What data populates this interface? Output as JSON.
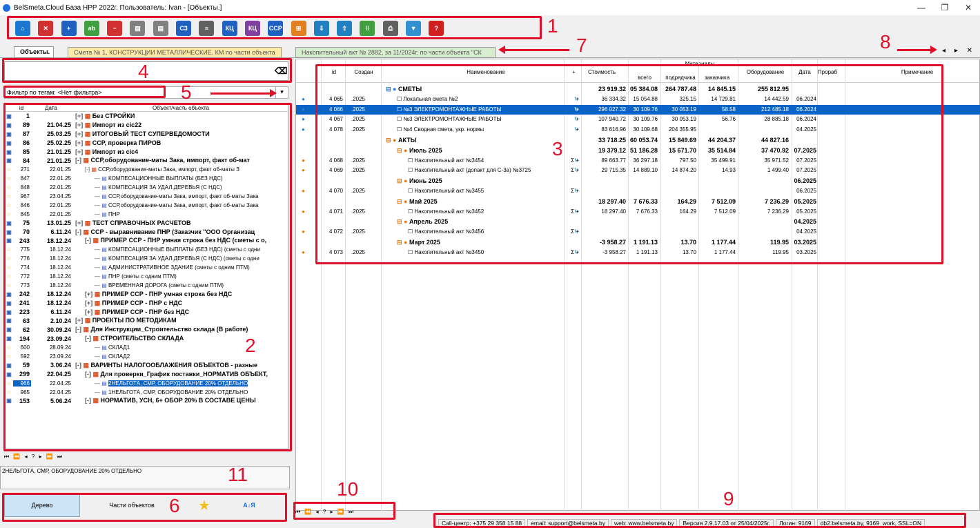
{
  "window": {
    "title": "BelSmeta.Cloud База НРР 2022г. Пользователь: Ivan - [Объекты.]",
    "minimize": "—",
    "maximize": "❐",
    "close": "✕"
  },
  "toolbar": [
    "home-icon",
    "delete-doc-icon",
    "add-icon",
    "rename-icon",
    "remove-icon",
    "copy-icon",
    "paste-icon",
    "c3-icon",
    "list-icon",
    "kc-icon",
    "kc-rem-icon",
    "ccp-icon",
    "merge-icon",
    "import-icon",
    "export-icon",
    "grid-icon",
    "print-icon",
    "filter-icon",
    "help-icon"
  ],
  "tabs": [
    {
      "label": "Объекты."
    },
    {
      "label": "Смета № 1, КОНСТРУКЦИИ МЕТАЛЛИЧЕСКИЕ. КМ по части объекта"
    },
    {
      "label": "Накопительный акт № 2882, за 11/2024г. по части объекта \"СК"
    }
  ],
  "tabnav": "◂ ▸ ✕",
  "search": {
    "value": ""
  },
  "filter": {
    "label": "Фильтр по тегам: <Нет фильтра>"
  },
  "tree": {
    "headers": {
      "id": "id",
      "date": "Дата",
      "name": "Объект/часть объекта"
    },
    "rows": [
      {
        "id": "1",
        "date": "",
        "name": "Без СТРОЙКИ",
        "lvl": 0,
        "bold": true,
        "exp": "+"
      },
      {
        "id": "89",
        "date": "21.04.25",
        "name": "Импорт из cic22",
        "lvl": 0,
        "bold": true,
        "exp": "+"
      },
      {
        "id": "87",
        "date": "25.03.25",
        "name": "ИТОГОВЫЙ ТЕСТ СУПЕРВЕДОМОСТИ",
        "lvl": 0,
        "bold": true,
        "exp": "+"
      },
      {
        "id": "86",
        "date": "25.02.25",
        "name": "ССР, проверка ПИРОВ",
        "lvl": 0,
        "bold": true,
        "exp": "+"
      },
      {
        "id": "85",
        "date": "21.01.25",
        "name": "Импорт из cic4",
        "lvl": 0,
        "bold": true,
        "exp": "+"
      },
      {
        "id": "84",
        "date": "21.01.25",
        "name": "ССР,оборудование-маты Зака, импорт, факт об-мат",
        "lvl": 0,
        "bold": true,
        "exp": "-"
      },
      {
        "id": "271",
        "date": "22.01.25",
        "name": "ССР,оборудование-маты Зака, импорт, факт об-маты З",
        "lvl": 1,
        "bold": false,
        "exp": "-"
      },
      {
        "id": "847",
        "date": "22.01.25",
        "name": "КОМПЕСАЦИОННЫЕ ВЫПЛАТЫ (БЕЗ НДС)",
        "lvl": 2,
        "bold": false,
        "exp": ""
      },
      {
        "id": "848",
        "date": "22.01.25",
        "name": "КОМПЕСАЦИЯ ЗА УДАЛ.ДЕРЕВЬЯ (С НДС)",
        "lvl": 2,
        "bold": false,
        "exp": ""
      },
      {
        "id": "967",
        "date": "23.04.25",
        "name": "ССР,оборудование-маты Зака, импорт, факт об-маты Зака",
        "lvl": 2,
        "bold": false,
        "exp": ""
      },
      {
        "id": "846",
        "date": "22.01.25",
        "name": "ССР,оборудование-маты Зака, импорт, факт об-маты Зака",
        "lvl": 2,
        "bold": false,
        "exp": ""
      },
      {
        "id": "845",
        "date": "22.01.25",
        "name": "ПНР",
        "lvl": 2,
        "bold": false,
        "exp": ""
      },
      {
        "id": "75",
        "date": "13.01.25",
        "name": "ТЕСТ СПРАВОЧНЫХ РАСЧЕТОВ",
        "lvl": 0,
        "bold": true,
        "exp": "+"
      },
      {
        "id": "70",
        "date": "6.11.24",
        "name": "ССР - выравнивание ПНР (Заказчик \"ООО Организац",
        "lvl": 0,
        "bold": true,
        "exp": "-"
      },
      {
        "id": "243",
        "date": "18.12.24",
        "name": "ПРИМЕР ССР - ПНР умная строка без НДС (сметы с о,",
        "lvl": 1,
        "bold": true,
        "exp": "-"
      },
      {
        "id": "775",
        "date": "18.12.24",
        "name": "КОМПЕСАЦИОННЫЕ ВЫПЛАТЫ (БЕЗ НДС) (сметы с одни",
        "lvl": 2,
        "bold": false,
        "exp": ""
      },
      {
        "id": "776",
        "date": "18.12.24",
        "name": "КОМПЕСАЦИЯ ЗА УДАЛ.ДЕРЕВЬЯ (С НДС) (сметы с одни",
        "lvl": 2,
        "bold": false,
        "exp": ""
      },
      {
        "id": "774",
        "date": "18.12.24",
        "name": "АДМИНИСТРАТИВНОЕ ЗДАНИЕ (сметы с одним ПТМ)",
        "lvl": 2,
        "bold": false,
        "exp": ""
      },
      {
        "id": "772",
        "date": "18.12.24",
        "name": "ПНР (сметы с одним ПТМ)",
        "lvl": 2,
        "bold": false,
        "exp": ""
      },
      {
        "id": "773",
        "date": "18.12.24",
        "name": "ВРЕМЕННАЯ ДОРОГА (сметы с одним ПТМ)",
        "lvl": 2,
        "bold": false,
        "exp": ""
      },
      {
        "id": "242",
        "date": "18.12.24",
        "name": "ПРИМЕР ССР - ПНР умная строка без НДС",
        "lvl": 1,
        "bold": true,
        "exp": "+"
      },
      {
        "id": "241",
        "date": "18.12.24",
        "name": "ПРИМЕР ССР - ПНР с НДС",
        "lvl": 1,
        "bold": true,
        "exp": "+"
      },
      {
        "id": "223",
        "date": "6.11.24",
        "name": "ПРИМЕР ССР - ПНР без НДС",
        "lvl": 1,
        "bold": true,
        "exp": "+"
      },
      {
        "id": "63",
        "date": "2.10.24",
        "name": "ПРОЕКТЫ ПО МЕТОДИКАМ",
        "lvl": 0,
        "bold": true,
        "exp": "+"
      },
      {
        "id": "62",
        "date": "30.09.24",
        "name": "Для Инструкции_Строительство склада (В работе)",
        "lvl": 0,
        "bold": true,
        "exp": "-"
      },
      {
        "id": "194",
        "date": "23.09.24",
        "name": "СТРОИТЕЛЬСТВО СКЛАДА",
        "lvl": 1,
        "bold": true,
        "exp": "-"
      },
      {
        "id": "600",
        "date": "28.09.24",
        "name": "СКЛАД1",
        "lvl": 2,
        "bold": false,
        "exp": ""
      },
      {
        "id": "592",
        "date": "23.09.24",
        "name": "СКЛАД2",
        "lvl": 2,
        "bold": false,
        "exp": ""
      },
      {
        "id": "59",
        "date": "3.06.24",
        "name": "ВАРИНТЫ НАЛОГООБЛАЖЕНИЯ ОБЪЕКТОВ - разные",
        "lvl": 0,
        "bold": true,
        "exp": "-"
      },
      {
        "id": "299",
        "date": "22.04.25",
        "name": "Для проверки_График поставки_НОРМАТИВ ОБЪЕКТ,",
        "lvl": 1,
        "bold": true,
        "exp": "-"
      },
      {
        "id": "966",
        "date": "22.04.25",
        "name": "2НЕЛЬГОТА, СМР, ОБОРУДОВАНИЕ 20% ОТДЕЛЬНО",
        "lvl": 2,
        "bold": false,
        "exp": "",
        "sel": true
      },
      {
        "id": "965",
        "date": "22.04.25",
        "name": "1НЕЛЬГОТА, СМР, ОБОРУДОВАНИЕ 20% ОТДЕЛЬНО",
        "lvl": 2,
        "bold": false,
        "exp": ""
      },
      {
        "id": "153",
        "date": "5.06.24",
        "name": "НОРМАТИВ, УСН, 6+ ОБОР 20% В СОСТАВЕ ЦЕНЫ",
        "lvl": 1,
        "bold": true,
        "exp": "-"
      }
    ]
  },
  "left_nav": "⏮ ⏪ ◂ ? ▸ ⏩ ⏭",
  "selected_desc": "2НЕЛЬГОТА, СМР, ОБОРУДОВАНИЕ 20% ОТДЕЛЬНО",
  "bottom_tabs": {
    "tree": "Дерево",
    "parts": "Части объектов",
    "sort": "А↓Я"
  },
  "grid": {
    "headers": {
      "id": "id",
      "created": "Создан",
      "name": "Наименование",
      "plus": "+",
      "cost": "Стоимость",
      "materials": "Материалы",
      "all": "всего",
      "contractor": "подрядчика",
      "customer": "заказчика",
      "equipment": "Оборудование",
      "date": "Дата",
      "foreman": "Прораб",
      "note": "Примечание"
    },
    "rows": [
      {
        "id": "",
        "cr": "",
        "name": "СМЕТЫ",
        "lvl": 0,
        "bold": true,
        "cost": "23 919.32",
        "c2": "05 384.08",
        "m1": "264 787.48",
        "m2": "14 845.15",
        "eq": "255 812.95",
        "dt": "",
        "sig": ""
      },
      {
        "id": "4 065",
        "cr": ".2025",
        "name": "Локальная смета №2",
        "lvl": 1,
        "bold": false,
        "cost": "36 334.32",
        "c2": "15 054.88",
        "m1": "325.15",
        "m2": "14 729.81",
        "eq": "14 442.59",
        "dt": "06.2024",
        "sig": "+"
      },
      {
        "id": "4 066",
        "cr": ".2025",
        "name": "№3 ЭЛЕКТРОМОНТАЖНЫЕ РАБОТЫ",
        "lvl": 1,
        "bold": false,
        "cost": "296 027.32",
        "c2": "30 109.76",
        "m1": "30 053.19",
        "m2": "58.58",
        "eq": "212 485.18",
        "dt": "06.2024",
        "sig": "+",
        "sel": true
      },
      {
        "id": "4 067",
        "cr": ".2025",
        "name": "№3 ЭЛЕКТРОМОНТАЖНЫЕ РАБОТЫ",
        "lvl": 1,
        "bold": false,
        "cost": "107 940.72",
        "c2": "30 109.76",
        "m1": "30 053.19",
        "m2": "56.76",
        "eq": "28 885.18",
        "dt": "06.2024",
        "sig": "+"
      },
      {
        "id": "4 078",
        "cr": ".2025",
        "name": "№4 Сводная смета, укр. нормы",
        "lvl": 1,
        "bold": false,
        "cost": "83 616.96",
        "c2": "30 109.68",
        "m1": "204 355.95",
        "m2": "",
        "eq": "",
        "dt": "04.2025",
        "sig": "+"
      },
      {
        "id": "",
        "cr": "",
        "name": "АКТЫ",
        "lvl": 0,
        "bold": true,
        "cost": "33 718.25",
        "c2": "60 053.74",
        "m1": "15 849.69",
        "m2": "44 204.37",
        "eq": "44 827.16",
        "dt": "",
        "sig": ""
      },
      {
        "id": "",
        "cr": "",
        "name": "Июль 2025",
        "lvl": 1,
        "bold": true,
        "cost": "19 379.12",
        "c2": "51 186.28",
        "m1": "15 671.70",
        "m2": "35 514.84",
        "eq": "37 470.92",
        "dt": "07.2025",
        "sig": ""
      },
      {
        "id": "4 068",
        "cr": ".2025",
        "name": "Накопительный акт №3454",
        "lvl": 2,
        "bold": false,
        "cost": "89 663.77",
        "c2": "36 297.18",
        "m1": "797.50",
        "m2": "35 499.91",
        "eq": "35 971.52",
        "dt": "07.2025",
        "sig": "Σ +"
      },
      {
        "id": "4 069",
        "cr": ".2025",
        "name": "Накопительный акт (допакт для С-3а) №3725",
        "lvl": 2,
        "bold": false,
        "cost": "29 715.35",
        "c2": "14 889.10",
        "m1": "14 874.20",
        "m2": "14.93",
        "eq": "1 499.40",
        "dt": "07.2025",
        "sig": "Σ +"
      },
      {
        "id": "",
        "cr": "",
        "name": "Июнь 2025",
        "lvl": 1,
        "bold": true,
        "cost": "",
        "c2": "",
        "m1": "",
        "m2": "",
        "eq": "",
        "dt": "06.2025",
        "sig": ""
      },
      {
        "id": "4 070",
        "cr": ".2025",
        "name": "Накопительный акт №3455",
        "lvl": 2,
        "bold": false,
        "cost": "",
        "c2": "",
        "m1": "",
        "m2": "",
        "eq": "",
        "dt": "06.2025",
        "sig": "Σ +"
      },
      {
        "id": "",
        "cr": "",
        "name": "Май 2025",
        "lvl": 1,
        "bold": true,
        "cost": "18 297.40",
        "c2": "7 676.33",
        "m1": "164.29",
        "m2": "7 512.09",
        "eq": "7 236.29",
        "dt": "05.2025",
        "sig": ""
      },
      {
        "id": "4 071",
        "cr": ".2025",
        "name": "Накопительный акт №3452",
        "lvl": 2,
        "bold": false,
        "cost": "18 297.40",
        "c2": "7 676.33",
        "m1": "164.29",
        "m2": "7 512.09",
        "eq": "7 236.29",
        "dt": "05.2025",
        "sig": "Σ +"
      },
      {
        "id": "",
        "cr": "",
        "name": "Апрель 2025",
        "lvl": 1,
        "bold": true,
        "cost": "",
        "c2": "",
        "m1": "",
        "m2": "",
        "eq": "",
        "dt": "04.2025",
        "sig": ""
      },
      {
        "id": "4 072",
        "cr": ".2025",
        "name": "Накопительный акт №3456",
        "lvl": 2,
        "bold": false,
        "cost": "",
        "c2": "",
        "m1": "",
        "m2": "",
        "eq": "",
        "dt": "04.2025",
        "sig": "Σ +"
      },
      {
        "id": "",
        "cr": "",
        "name": "Март 2025",
        "lvl": 1,
        "bold": true,
        "cost": "-3 958.27",
        "c2": "1 191.13",
        "m1": "13.70",
        "m2": "1 177.44",
        "eq": "119.95",
        "dt": "03.2025",
        "sig": ""
      },
      {
        "id": "4 073",
        "cr": ".2025",
        "name": "Накопительный акт №3450",
        "lvl": 2,
        "bold": false,
        "cost": "-3 958.27",
        "c2": "1 191.13",
        "m1": "13.70",
        "m2": "1 177.44",
        "eq": "119.95",
        "dt": "03.2025",
        "sig": "Σ +"
      }
    ]
  },
  "right_nav": "⏮ ⏪ ◂ ? ▸ ⏩ ⏭",
  "statusbar": [
    "Call-центр: +375 29 358 15 88",
    "email: support@belsmeta.by",
    "web: www.belsmeta.by",
    "Версия 2.9.17.03 от 25/04/2025г.",
    "Логин: 9169",
    "db2.belsmeta.by, 9169_work, SSL=ON"
  ],
  "annotations": [
    "1",
    "2",
    "3",
    "4",
    "5",
    "6",
    "7",
    "8",
    "9",
    "10",
    "11"
  ]
}
